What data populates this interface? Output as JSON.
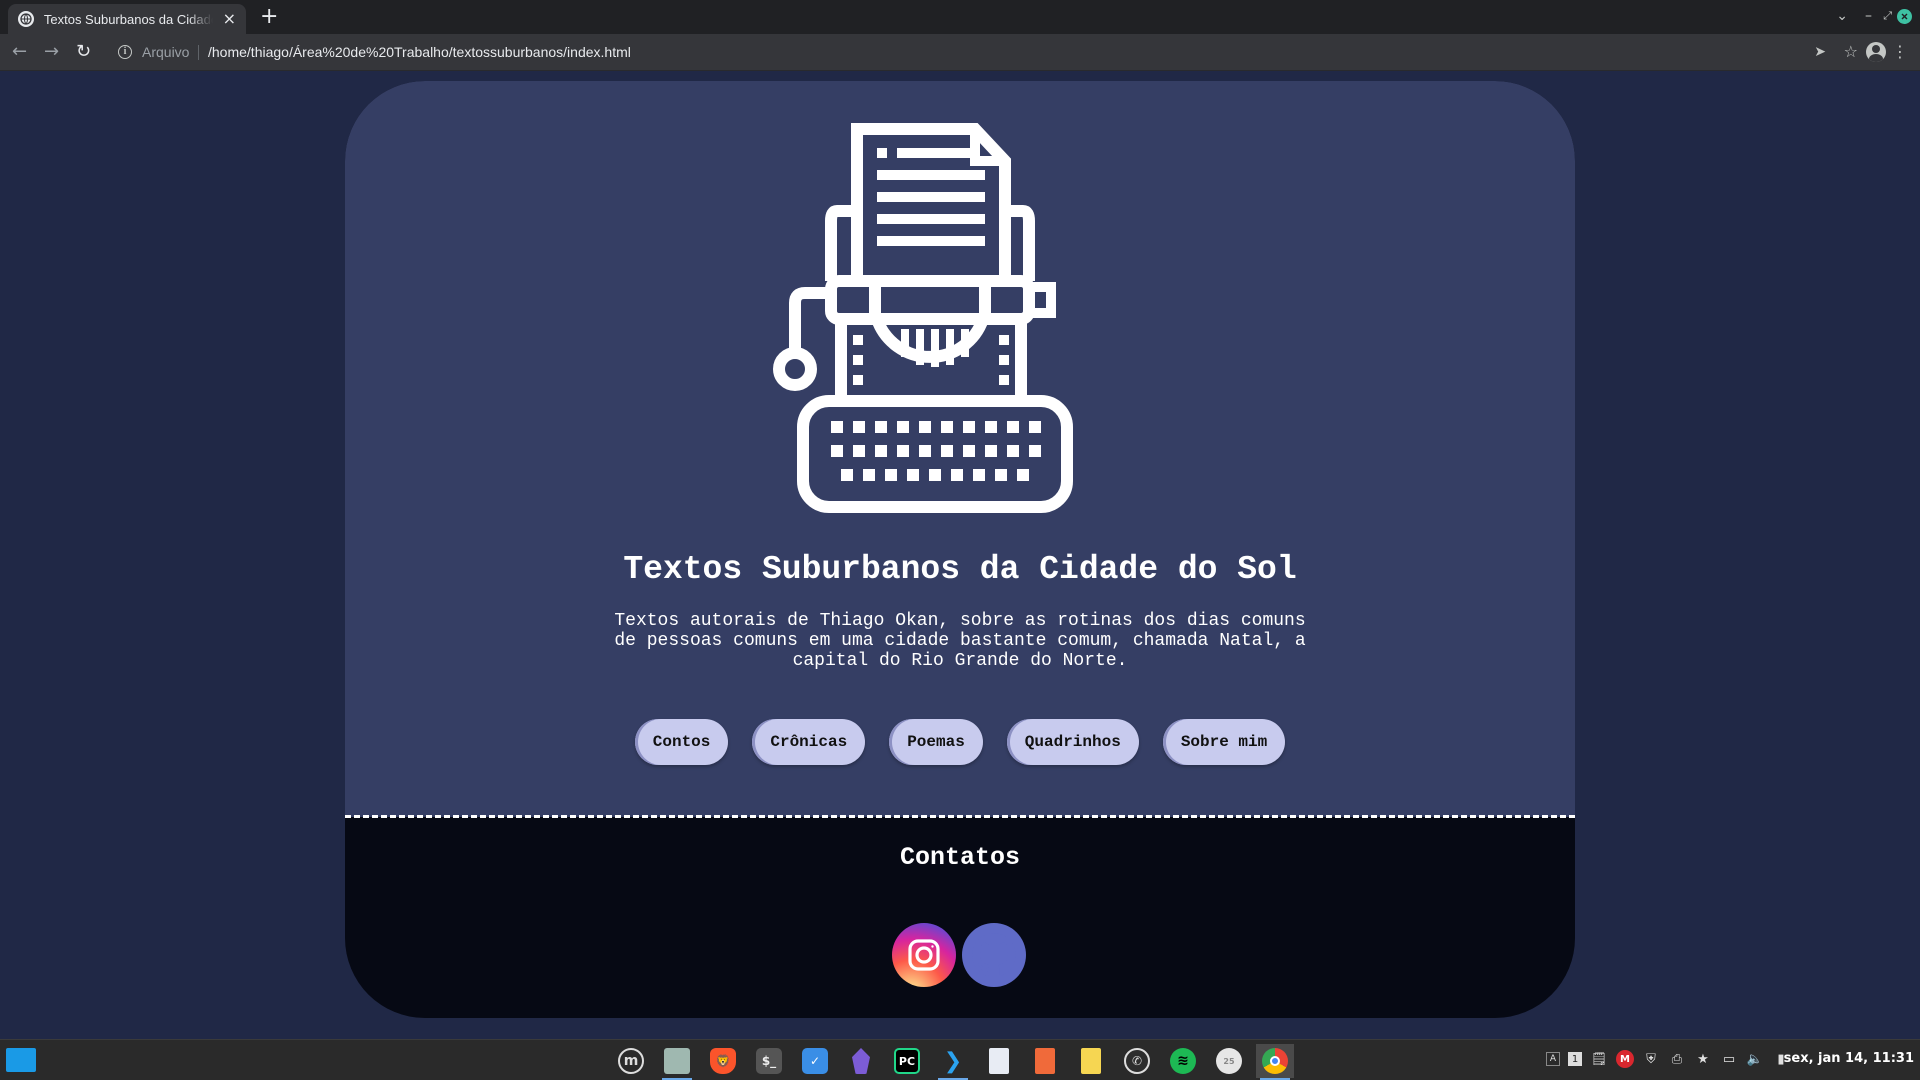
{
  "browser": {
    "tab_title": "Textos Suburbanos da Cidade do Sol",
    "new_tab_symbol": "+",
    "scheme_label": "Arquivo",
    "url": "/home/thiago/Área%20de%20Trabalho/textossuburbanos/index.html"
  },
  "page": {
    "title": "Textos Suburbanos da Cidade do Sol",
    "description": "Textos autorais de Thiago Okan, sobre as rotinas dos dias comuns de pessoas comuns em uma cidade bastante comum, chamada Natal, a capital do Rio Grande do Norte.",
    "nav": [
      "Contos",
      "Crônicas",
      "Poemas",
      "Quadrinhos",
      "Sobre mim"
    ],
    "footer_title": "Contatos",
    "social_icons": [
      "instagram-icon",
      "github-icon"
    ],
    "colors": {
      "background": "#202846",
      "hero": "#353e64",
      "footer": "#060914",
      "nav_pill": "#c8cbee"
    }
  },
  "taskbar": {
    "clock": "sex, jan 14, 11:31",
    "apps": [
      "mint-menu-icon",
      "files-icon",
      "brave-icon",
      "terminal-icon",
      "tasks-icon",
      "obsidian-icon",
      "pycharm-icon",
      "vscode-icon",
      "text-editor-icon",
      "document-viewer-icon",
      "notes-icon",
      "whatsapp-icon",
      "spotify-icon",
      "calendar-icon",
      "chrome-icon"
    ],
    "pycharm_label": "PC",
    "terminal_label": "$_",
    "calendar_label": "25"
  }
}
